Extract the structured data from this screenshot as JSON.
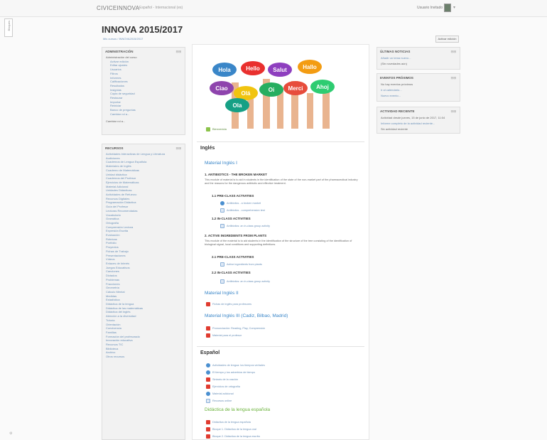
{
  "topbar": {
    "brand": "CIVICEINNOVA",
    "language": "Español - Internacional (es)",
    "user": "Usuario Invitado"
  },
  "sidetab": {
    "label": "Bloques"
  },
  "page": {
    "title": "INNOVA 2015/2017",
    "breadcrumb": "Mis cursos / INNOVA2015/2017",
    "edit_button": "Activar edición"
  },
  "admin_block": {
    "title": "ADMINISTRACIÓN",
    "items": [
      "Administración del curso",
      "Activar edición",
      "Editar ajustes",
      "Usuarios",
      "Filtros",
      "Informes",
      "Calificaciones",
      "Resultados",
      "Insignias",
      "Copia de seguridad",
      "Restaurar",
      "Importar",
      "Reiniciar",
      "Banco de preguntas",
      "Cambiar rol a..."
    ],
    "footer": "Cambiar rol a..."
  },
  "resources_block": {
    "title": "RECURSOS",
    "items": [
      "Actividades Interactivas de Lengua y Literatura",
      "Audiciones",
      "Cuadernos de Lengua Española",
      "Materiales de Inglés",
      "Cuaderno de Matemáticas",
      "Unidad didáctica",
      "Cuadernos del Profesor",
      "Ejercicios de Matemáticas",
      "Material Adicional",
      "Unidades Didácticas",
      "Actividades de Refuerzo",
      "Recursos Digitales",
      "Programación Didáctica",
      "Guía del Profesor",
      "Lecturas Recomendadas",
      "Vocabulario",
      "Gramática",
      "Ortografía",
      "Comprensión Lectora",
      "Expresión Escrita",
      "Evaluación",
      "Rúbricas",
      "Portfolio",
      "Proyectos",
      "Fichas de Trabajo",
      "Presentaciones",
      "Vídeos",
      "Enlaces de Interés",
      "Juegos Educativos",
      "Canciones",
      "Dictados",
      "Problemas",
      "Fracciones",
      "Geometría",
      "Cálculo Mental",
      "Medidas",
      "Estadística",
      "Didáctica de la lengua",
      "Didáctica de las matemáticas",
      "Didáctica del inglés",
      "Atención a la diversidad",
      "Tutoría",
      "Orientación",
      "Convivencia",
      "Familias",
      "Formación del profesorado",
      "Innovación educativa",
      "Recursos TIC",
      "Biblioteca",
      "Archivo",
      "Otros recursos"
    ]
  },
  "news_block": {
    "title": "ÚLTIMAS NOTICIAS",
    "link": "Añadir un tema nuevo...",
    "text": "(Sin novedades aún)"
  },
  "events_block": {
    "title": "EVENTOS PRÓXIMOS",
    "text": "No hay eventos próximos",
    "link1": "Ir al calendario...",
    "link2": "Nuevo evento..."
  },
  "activity_block": {
    "title": "ACTIVIDAD RECIENTE",
    "text": "Actividad desde jueves, 15 de junio de 2017, 11:04",
    "link": "Informe completo de la actividad reciente...",
    "footer": "Sin actividad reciente"
  },
  "main": {
    "hero_caption": "Bienvenida",
    "hero_words": [
      "Hola",
      "Hello",
      "Salut",
      "Hallo",
      "Ciao",
      "Olá",
      "Oi",
      "Merci",
      "Ahoj",
      "Ola"
    ],
    "ingles": {
      "title": "Inglés",
      "material1_title": "Material Inglés I",
      "unit1_title": "1. ANTIBIOTICS - THE BROKEN MARKET",
      "unit1_para": "This module of material is to aid in students in the identification of the state of the non-market part of the pharmaceutical industry and the reasons for the dangerous antibiotic and effective treatment.",
      "unit1_pre": "1.1 PRE-CLASS ACTIVITIES",
      "unit1_res1": "Antibiotics - a broken market",
      "unit1_res2": "Antibiotics - comprehension test",
      "unit1_in": "1.2 IN-CLASS ACTIVITIES",
      "unit1_res3": "Antibiotics: an in-class group activity",
      "unit2_title": "2. ACTIVE INGREDIENTS FROM PLANTS",
      "unit2_para": "This module of the material is to aid students in the identification of the structure of the tree consisting of the identification of biological signal, local conditions and supporting definitions.",
      "unit2_pre": "2.1 PRE-CLASS ACTIVITIES",
      "unit2_res1": "Active ingredients from plants",
      "unit2_in": "2.2 IN-CLASS ACTIVITIES",
      "unit2_res2": "Antibiotics: an in-class group activity",
      "material2_title": "Material Inglés II",
      "material2_res": "Fichas de inglés para profesores",
      "material3_title": "Material Inglés III (Cadiz, Bilbao, Madrid)",
      "material3_res1": "Pronunciación: Reading, Play, Comprensión",
      "material3_res2": "Material para el profesor"
    },
    "espanol": {
      "title": "Español",
      "res": [
        "Actividades de lengua: los tiempos verbales",
        "El tiempo y los adverbios de tiempo",
        "Sintaxis de la oración",
        "Ejercicios de ortografía",
        "Material adicional",
        "Recursos online"
      ],
      "didactica_title": "Didáctica de la lengua española",
      "didactica_res": [
        "Didáctica de la lengua española",
        "Bloque 1. Didáctica de la lengua oral",
        "Bloque 2. Didáctica de la lengua escrita"
      ]
    }
  }
}
